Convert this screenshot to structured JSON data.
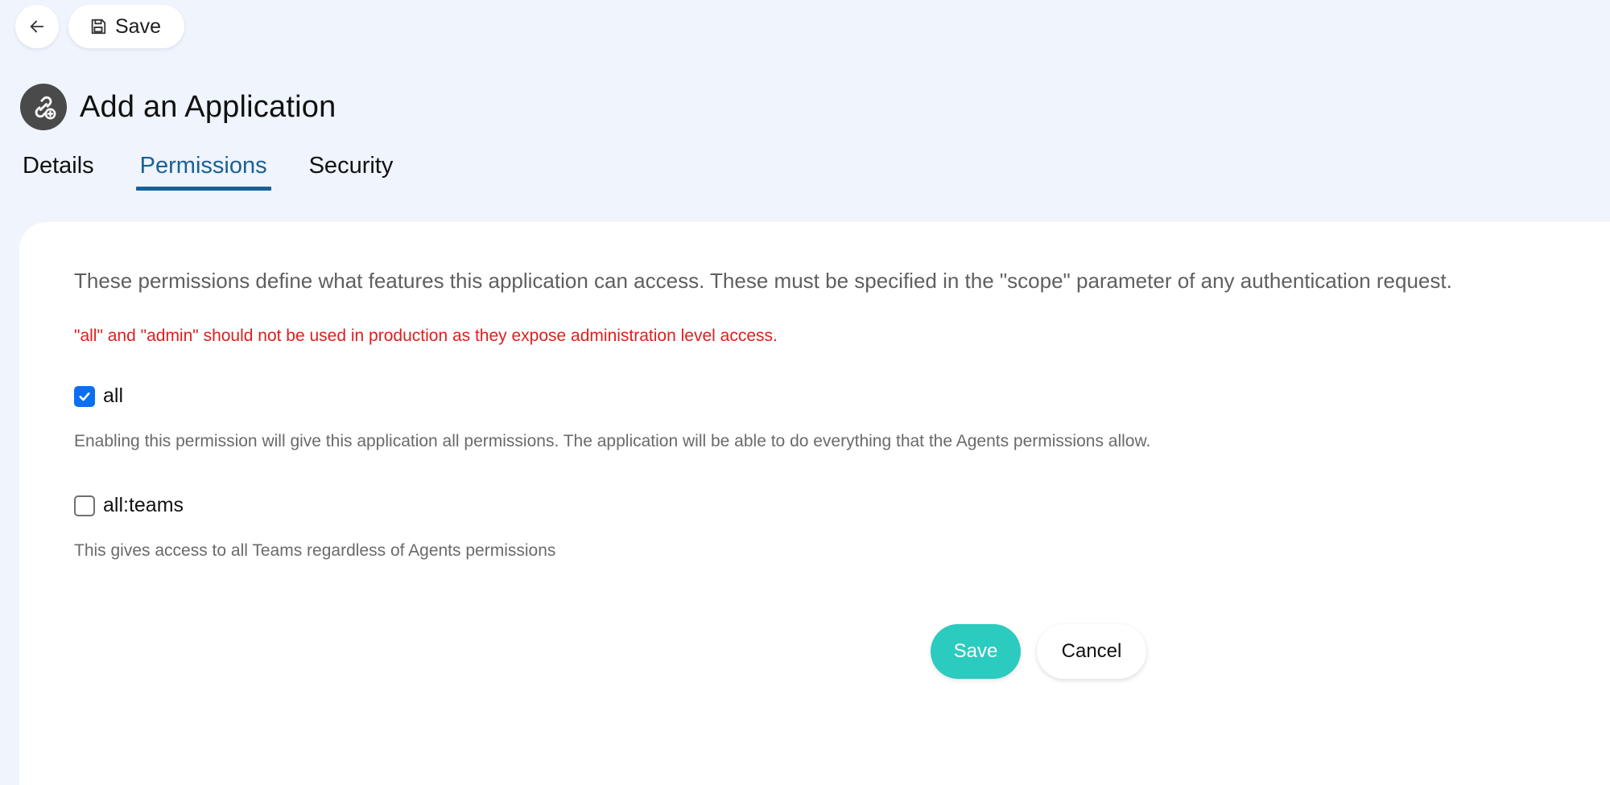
{
  "toolbar": {
    "back_icon": "arrow-left-icon",
    "save_icon": "floppy-disk-icon",
    "save_label": "Save"
  },
  "header": {
    "icon": "link-add-icon",
    "title": "Add an Application"
  },
  "tabs": [
    {
      "label": "Details",
      "active": false
    },
    {
      "label": "Permissions",
      "active": true
    },
    {
      "label": "Security",
      "active": false
    }
  ],
  "permissions_panel": {
    "intro": "These permissions define what features this application can access. These must be specified in the \"scope\" parameter of any authentication request.",
    "warning": "\"all\" and \"admin\" should not be used in production as they expose administration level access.",
    "items": [
      {
        "label": "all",
        "checked": true,
        "description": "Enabling this permission will give this application all permissions. The application will be able to do everything that the Agents permissions allow."
      },
      {
        "label": "all:teams",
        "checked": false,
        "description": "This gives access to all Teams regardless of Agents permissions"
      }
    ]
  },
  "actions": {
    "save_label": "Save",
    "cancel_label": "Cancel"
  },
  "colors": {
    "background": "#eff4fd",
    "accent_tab": "#1a6196",
    "save_button": "#2ccbbf",
    "warning_text": "#e01e1e",
    "checkbox_checked": "#0b6ef5"
  }
}
